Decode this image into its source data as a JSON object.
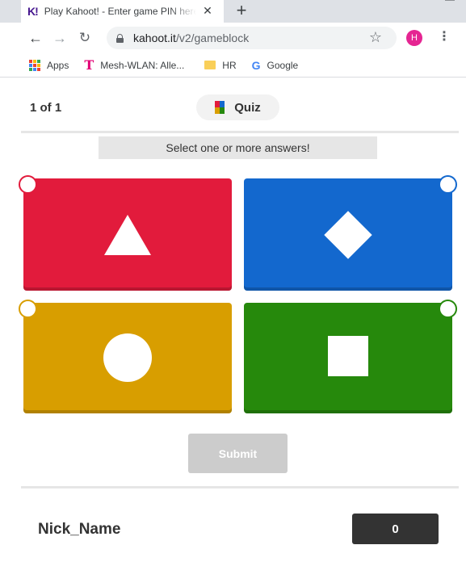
{
  "browser": {
    "tab_title": "Play Kahoot! - Enter game PIN here!",
    "tab_favicon": "K!",
    "new_tab_icon": "+",
    "url_host": "kahoot.it",
    "url_path": "/v2/gameblock",
    "profile_initial": "H",
    "profile_color": "#e52592",
    "bookmarks": [
      {
        "label": "Apps",
        "icon": "apps-grid-icon"
      },
      {
        "label": "Mesh-WLAN: Alle...",
        "icon": "telekom-icon"
      },
      {
        "label": "HR",
        "icon": "folder-icon"
      },
      {
        "label": "Google",
        "icon": "google-icon"
      }
    ]
  },
  "game": {
    "question_counter": "1 of 1",
    "question_type": "Quiz",
    "instruction": "Select one or more answers!",
    "answers": [
      {
        "shape": "triangle",
        "color": "#e21b3c",
        "selected": false
      },
      {
        "shape": "diamond",
        "color": "#1368ce",
        "selected": false
      },
      {
        "shape": "circle",
        "color": "#d89e00",
        "selected": false
      },
      {
        "shape": "square",
        "color": "#26890c",
        "selected": false
      }
    ],
    "submit_label": "Submit",
    "player_name": "Nick_Name",
    "score": "0"
  }
}
